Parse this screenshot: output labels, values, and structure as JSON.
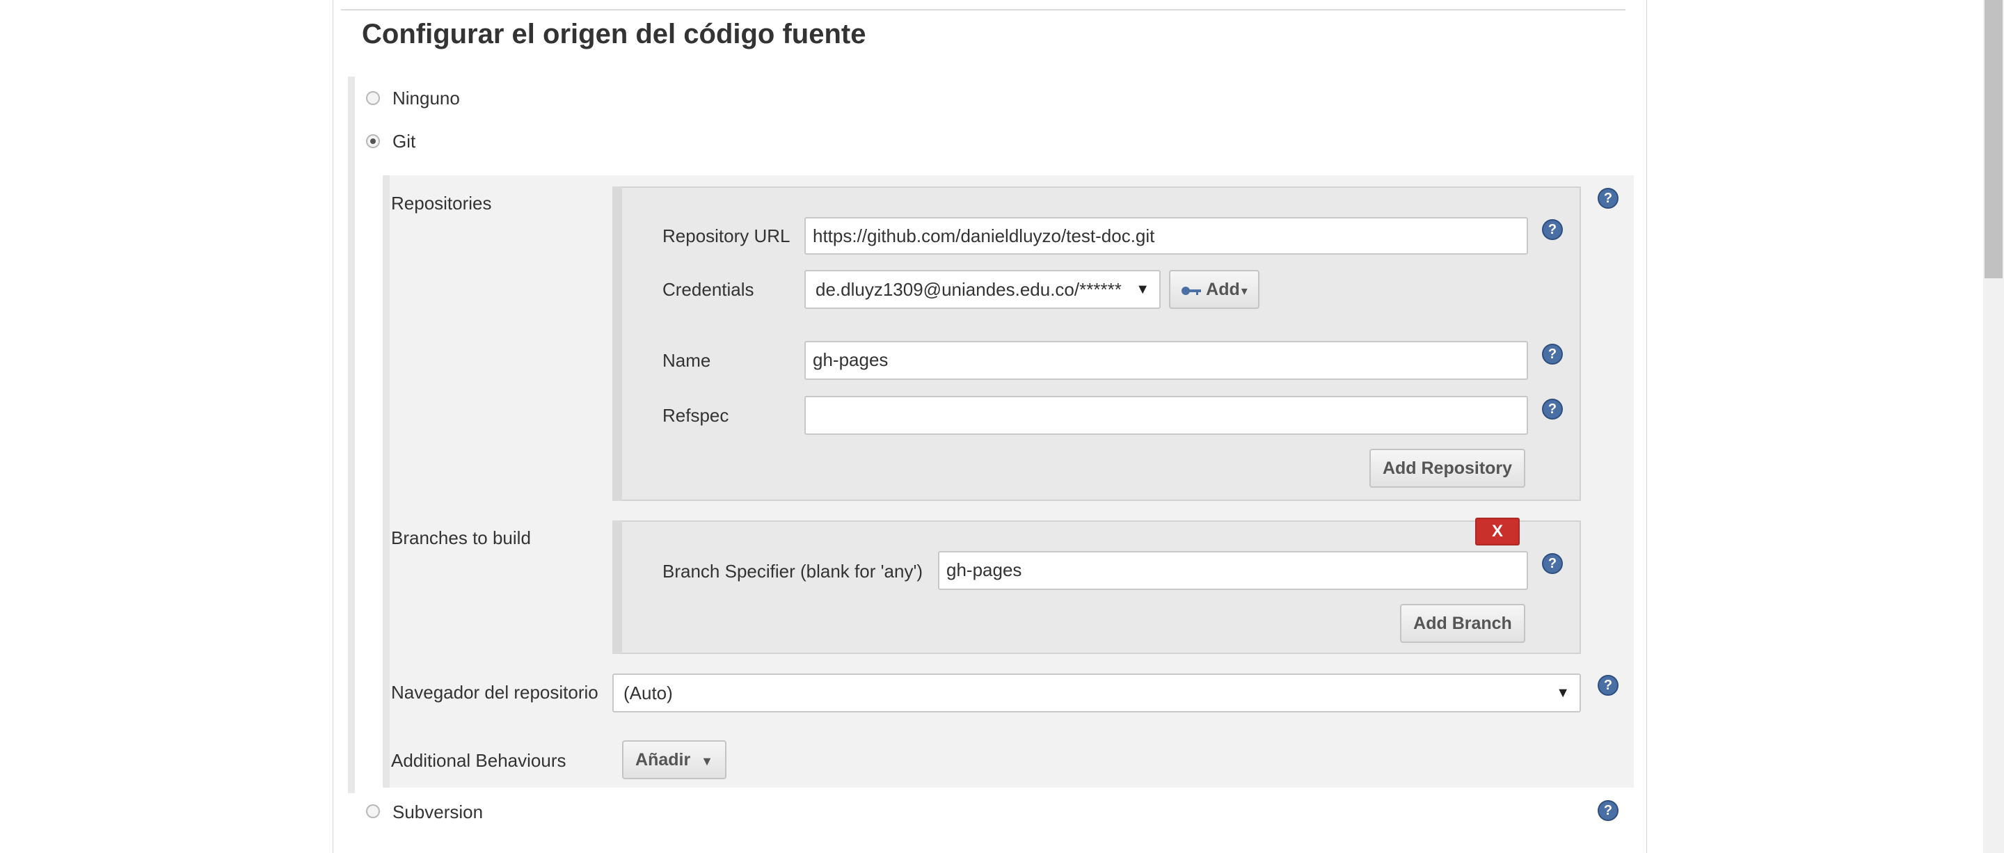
{
  "section": {
    "title": "Configurar el origen del código fuente"
  },
  "scm_options": {
    "none_label": "Ninguno",
    "git_label": "Git",
    "subversion_label": "Subversion",
    "selected": "Git"
  },
  "git": {
    "repositories_label": "Repositories",
    "repository_url_label": "Repository URL",
    "repository_url_value": "https://github.com/danieldluyzo/test-doc.git",
    "credentials_label": "Credentials",
    "credentials_value": "de.dluyz1309@uniandes.edu.co/******",
    "add_credentials_label": "Add",
    "name_label": "Name",
    "name_value": "gh-pages",
    "refspec_label": "Refspec",
    "refspec_value": "",
    "add_repository_label": "Add Repository",
    "branches_label": "Branches to build",
    "delete_branch_label": "X",
    "branch_specifier_label": "Branch Specifier (blank for 'any')",
    "branch_specifier_value": "gh-pages",
    "add_branch_label": "Add Branch",
    "repo_browser_label": "Navegador del repositorio",
    "repo_browser_value": "(Auto)",
    "additional_behaviours_label": "Additional Behaviours",
    "add_behaviour_label": "Añadir"
  },
  "icons": {
    "help": "help-icon",
    "key": "key-icon",
    "dropdown": "caret-down-icon"
  },
  "colors": {
    "help_icon": "#4a6fa5",
    "delete_button": "#c9302c",
    "git_panel_bg": "#f2f2f2"
  }
}
